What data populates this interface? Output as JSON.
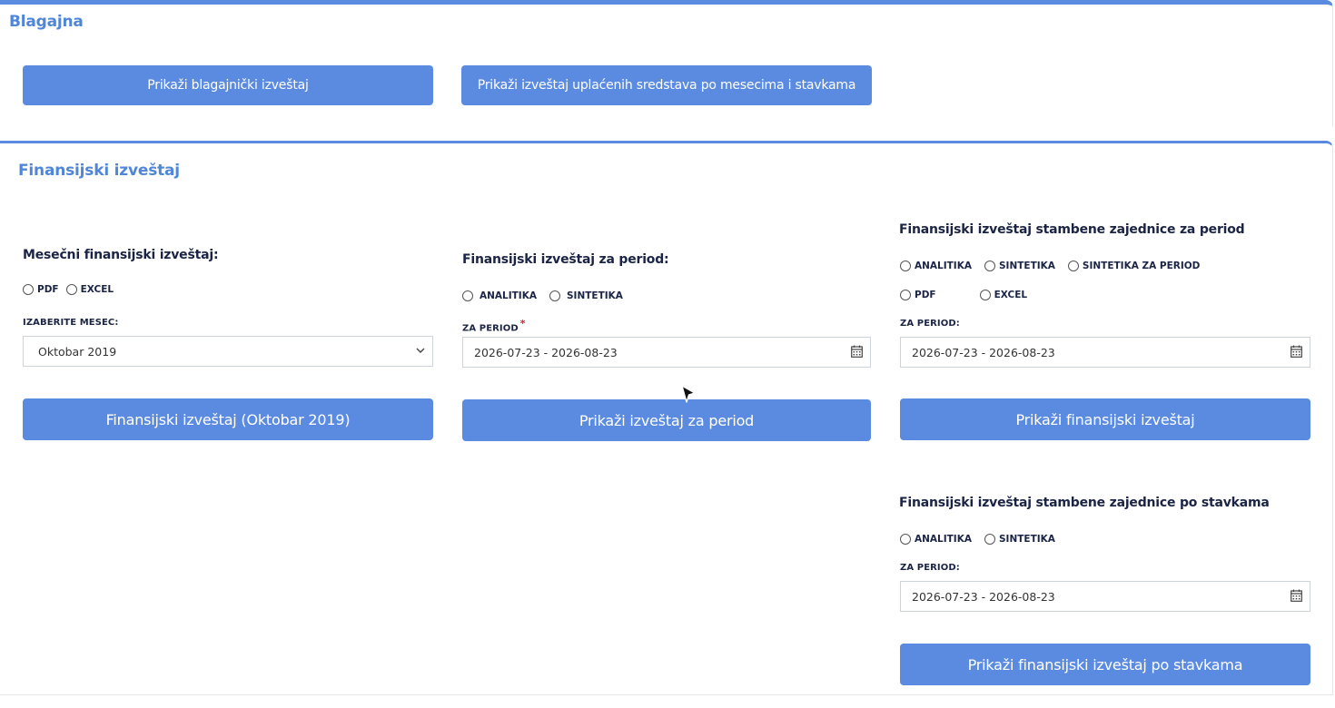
{
  "blagajna": {
    "title": "Blagajna",
    "btn_cash_report": "Prikaži blagajnički izveštaj",
    "btn_paid_report": "Prikaži izveštaj uplaćenih sredstava po mesecima i stavkama"
  },
  "finansijski": {
    "title": "Finansijski izveštaj",
    "monthly": {
      "heading": "Mesečni finansijski izveštaj:",
      "opt_pdf": "PDF",
      "opt_excel": "EXCEL",
      "month_label": "IZABERITE MESEC:",
      "month_value": "Oktobar 2019",
      "button": "Finansijski izveštaj (Oktobar 2019)"
    },
    "period": {
      "heading": "Finansijski izveštaj za period:",
      "opt_analitika": "ANALITIKA",
      "opt_sintetika": "SINTETIKA",
      "period_label": "ZA PERIOD",
      "required_mark": "*",
      "period_value": "2026-07-23 - 2026-08-23",
      "button": "Prikaži izveštaj za period"
    },
    "community_period": {
      "heading": "Finansijski izveštaj stambene zajednice za period",
      "opt_analitika": "ANALITIKA",
      "opt_sintetika": "SINTETIKA",
      "opt_sintetika_period": "SINTETIKA ZA PERIOD",
      "opt_pdf": "PDF",
      "opt_excel": "EXCEL",
      "period_label": "ZA PERIOD:",
      "period_value": "2026-07-23 - 2026-08-23",
      "button": "Prikaži finansijski izveštaj"
    },
    "community_items": {
      "heading": "Finansijski izveštaj stambene zajednice po stavkama",
      "opt_analitika": "ANALITIKA",
      "opt_sintetika": "SINTETIKA",
      "period_label": "ZA PERIOD:",
      "period_value": "2026-07-23 - 2026-08-23",
      "button": "Prikaži finansijski izveštaj po stavkama"
    }
  },
  "colors": {
    "accent": "#5b8be1",
    "title": "#4f86d8",
    "text": "#1b2445",
    "required": "#dd2222"
  },
  "icons": [
    "calendar-icon",
    "chevron-down-icon",
    "mouse-cursor-icon"
  ]
}
